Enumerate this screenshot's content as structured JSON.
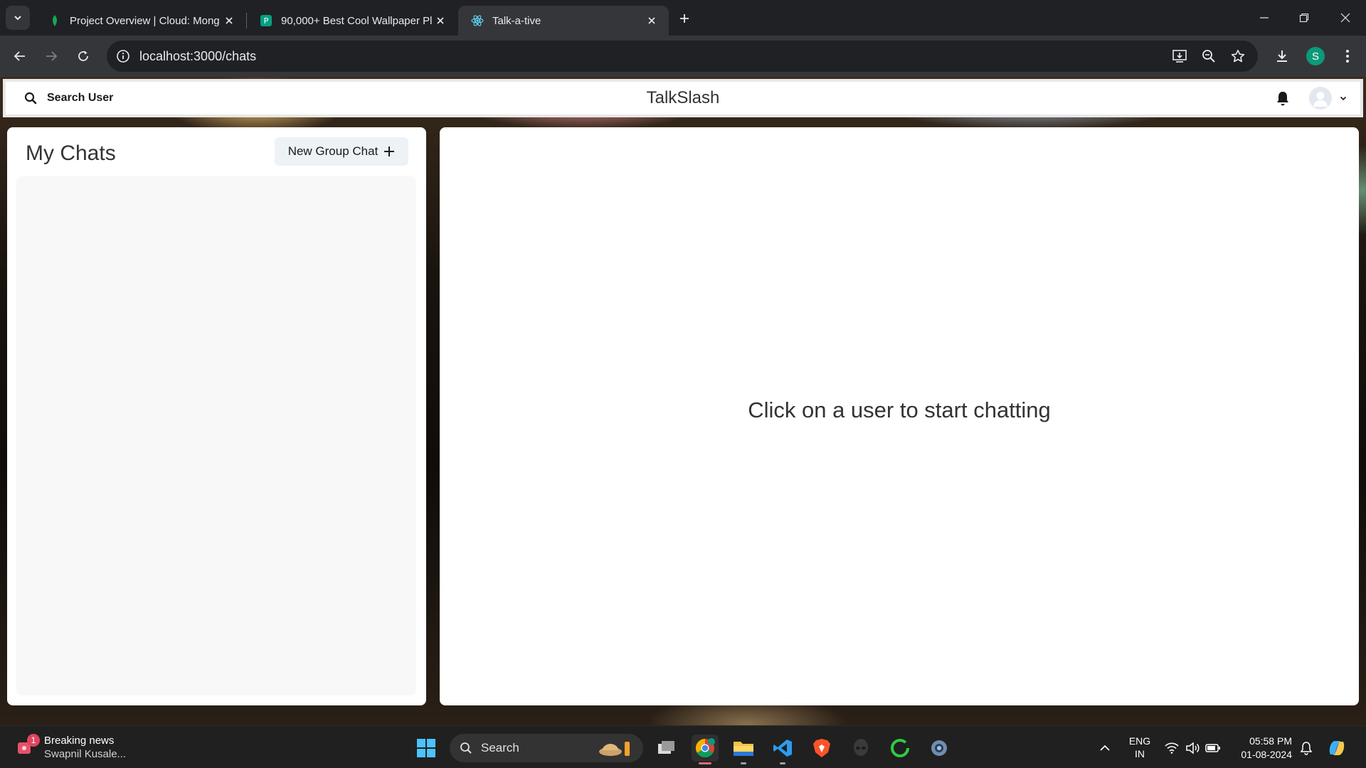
{
  "browser": {
    "tabs": [
      {
        "title": "Project Overview | Cloud: Mong",
        "active": false
      },
      {
        "title": "90,000+ Best Cool Wallpaper Pl",
        "active": false
      },
      {
        "title": "Talk-a-tive",
        "active": true
      }
    ],
    "url": "localhost:3000/chats",
    "profile_initial": "S"
  },
  "app": {
    "search_label": "Search User",
    "brand": "TalkSlash",
    "chats_title": "My Chats",
    "new_group_label": "New Group Chat",
    "empty_message": "Click on a user to start chatting"
  },
  "taskbar": {
    "news_title": "Breaking news",
    "news_subtitle": "Swapnil Kusale...",
    "news_badge": "1",
    "search_label": "Search",
    "lang_line1": "ENG",
    "lang_line2": "IN",
    "time": "05:58 PM",
    "date": "01-08-2024"
  },
  "colors": {
    "browser_dark": "#202124",
    "browser_toolbar": "#35363a",
    "panel_bg": "#ffffff",
    "chat_list_bg": "#f8f8f8",
    "button_bg": "#edf2f7"
  }
}
